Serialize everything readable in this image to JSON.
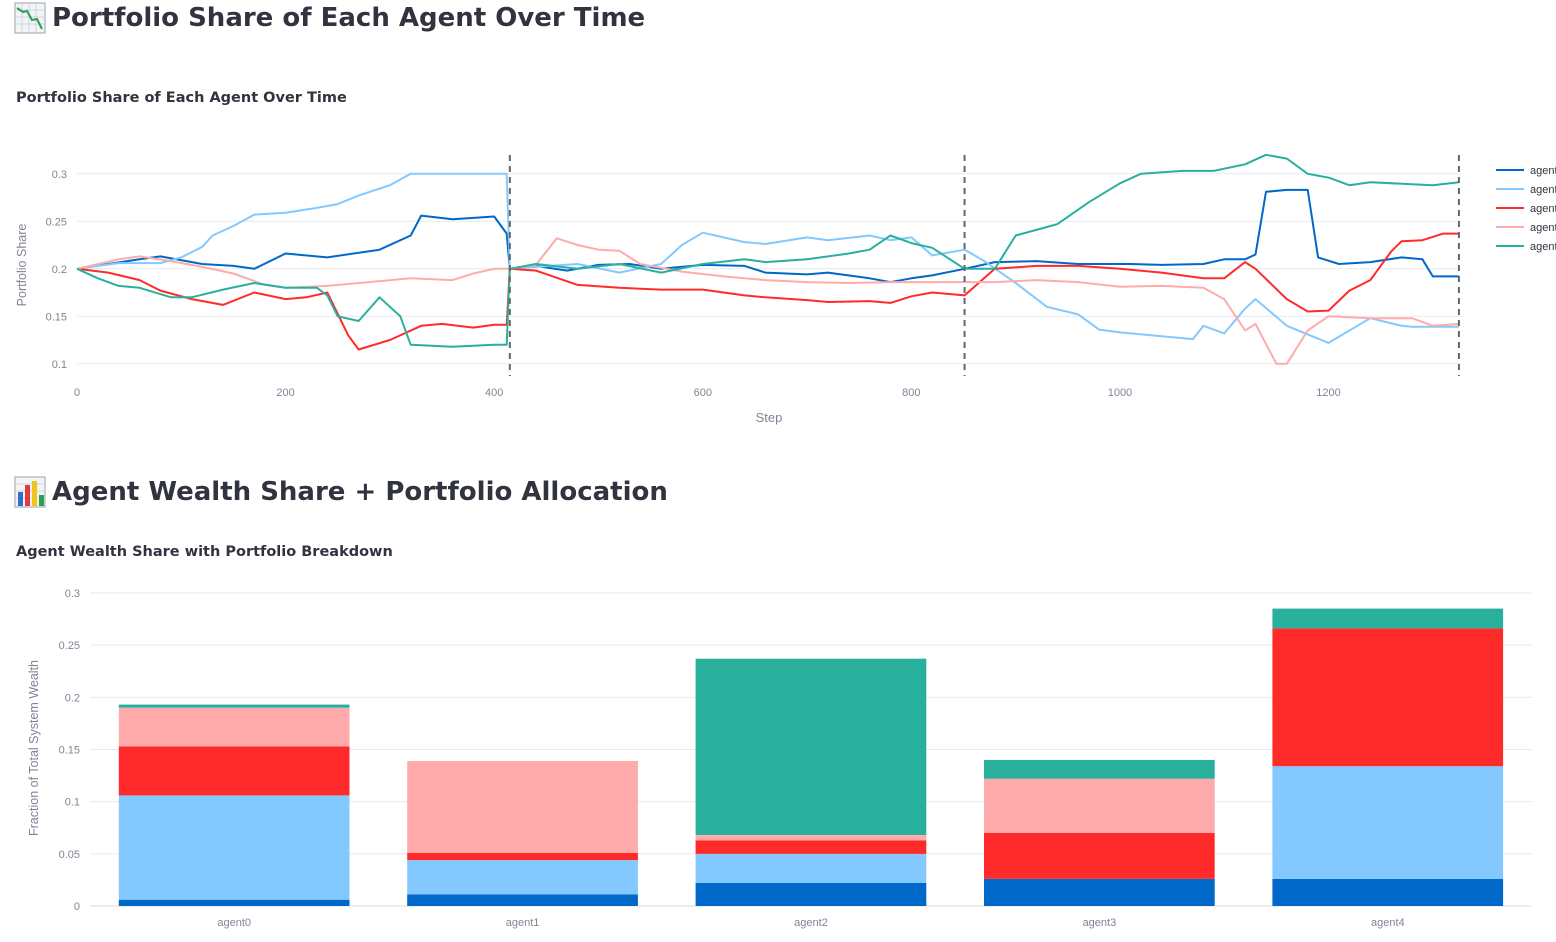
{
  "headings": {
    "line_section": "Portfolio Share of Each Agent Over Time",
    "line_icon": "chart-decreasing-icon",
    "bar_section": "Agent Wealth Share + Portfolio Allocation",
    "bar_icon": "bar-chart-icon"
  },
  "colors": {
    "agent0": "#0068c9",
    "agent1": "#83c9ff",
    "agent2": "#ff2b2b",
    "agent3": "#ffabab",
    "agent4": "#29b09d",
    "grid": "#e6e9ef",
    "axis_text": "#808495",
    "vline": "#666666"
  },
  "chart_data": [
    {
      "type": "line",
      "title": "Portfolio Share of Each Agent Over Time",
      "xlabel": "Step",
      "ylabel": "Portfolio Share",
      "xlim": [
        0,
        1327
      ],
      "ylim": [
        0.085,
        0.325
      ],
      "x_ticks": [
        0,
        200,
        400,
        600,
        800,
        1000,
        1200
      ],
      "y_ticks": [
        0.1,
        0.15,
        0.2,
        0.25,
        0.3
      ],
      "y_tick_labels": [
        "0.1",
        "0.15",
        "0.2",
        "0.25",
        "0.3"
      ],
      "vlines": [
        415,
        851,
        1325
      ],
      "grid": true,
      "legend": "right",
      "legend_labels": [
        "agent",
        "agent",
        "agent",
        "agent",
        "agent"
      ],
      "series": [
        {
          "color_key": "agent0",
          "x": [
            0,
            30,
            60,
            80,
            120,
            150,
            170,
            200,
            240,
            290,
            320,
            330,
            360,
            400,
            412,
            415,
            440,
            470,
            500,
            530,
            560,
            600,
            640,
            660,
            700,
            720,
            760,
            780,
            800,
            820,
            851,
            880,
            920,
            960,
            1010,
            1040,
            1080,
            1100,
            1120,
            1130,
            1140,
            1160,
            1180,
            1190,
            1210,
            1240,
            1270,
            1290,
            1300,
            1310,
            1325
          ],
          "y": [
            0.2,
            0.205,
            0.21,
            0.213,
            0.205,
            0.203,
            0.2,
            0.216,
            0.212,
            0.22,
            0.235,
            0.256,
            0.252,
            0.255,
            0.237,
            0.2,
            0.203,
            0.198,
            0.204,
            0.205,
            0.2,
            0.204,
            0.203,
            0.196,
            0.194,
            0.196,
            0.19,
            0.186,
            0.19,
            0.193,
            0.2,
            0.207,
            0.208,
            0.205,
            0.205,
            0.204,
            0.205,
            0.21,
            0.21,
            0.215,
            0.281,
            0.283,
            0.283,
            0.212,
            0.205,
            0.207,
            0.212,
            0.21,
            0.192,
            0.192,
            0.192
          ]
        },
        {
          "color_key": "agent1",
          "x": [
            0,
            40,
            80,
            100,
            120,
            130,
            150,
            170,
            200,
            230,
            250,
            270,
            300,
            320,
            380,
            400,
            412,
            415,
            440,
            480,
            520,
            560,
            580,
            600,
            640,
            660,
            700,
            720,
            760,
            780,
            800,
            820,
            851,
            870,
            900,
            930,
            960,
            980,
            1000,
            1040,
            1070,
            1080,
            1100,
            1120,
            1130,
            1160,
            1200,
            1240,
            1270,
            1280,
            1325
          ],
          "y": [
            0.2,
            0.206,
            0.206,
            0.212,
            0.223,
            0.235,
            0.245,
            0.257,
            0.259,
            0.264,
            0.268,
            0.277,
            0.288,
            0.3,
            0.3,
            0.3,
            0.3,
            0.2,
            0.202,
            0.205,
            0.196,
            0.205,
            0.225,
            0.238,
            0.228,
            0.226,
            0.233,
            0.23,
            0.235,
            0.23,
            0.233,
            0.214,
            0.22,
            0.208,
            0.185,
            0.16,
            0.152,
            0.136,
            0.133,
            0.129,
            0.126,
            0.14,
            0.132,
            0.158,
            0.168,
            0.14,
            0.122,
            0.148,
            0.14,
            0.139,
            0.139
          ]
        },
        {
          "color_key": "agent2",
          "x": [
            0,
            30,
            60,
            80,
            110,
            140,
            170,
            200,
            220,
            240,
            260,
            270,
            300,
            330,
            350,
            380,
            400,
            412,
            415,
            440,
            480,
            520,
            560,
            600,
            640,
            660,
            700,
            720,
            760,
            780,
            800,
            820,
            851,
            880,
            920,
            960,
            1000,
            1040,
            1080,
            1100,
            1120,
            1130,
            1160,
            1180,
            1200,
            1220,
            1240,
            1260,
            1270,
            1290,
            1310,
            1325
          ],
          "y": [
            0.2,
            0.196,
            0.188,
            0.177,
            0.168,
            0.162,
            0.175,
            0.168,
            0.17,
            0.175,
            0.13,
            0.115,
            0.125,
            0.14,
            0.142,
            0.138,
            0.141,
            0.141,
            0.2,
            0.198,
            0.183,
            0.18,
            0.178,
            0.178,
            0.172,
            0.17,
            0.167,
            0.165,
            0.166,
            0.164,
            0.171,
            0.175,
            0.172,
            0.2,
            0.203,
            0.203,
            0.2,
            0.196,
            0.19,
            0.19,
            0.207,
            0.2,
            0.168,
            0.155,
            0.156,
            0.177,
            0.188,
            0.218,
            0.229,
            0.23,
            0.237,
            0.237
          ]
        },
        {
          "color_key": "agent3",
          "x": [
            0,
            40,
            60,
            90,
            120,
            150,
            180,
            200,
            240,
            280,
            320,
            360,
            380,
            400,
            412,
            415,
            440,
            460,
            480,
            500,
            520,
            540,
            580,
            620,
            660,
            700,
            740,
            780,
            820,
            851,
            880,
            920,
            960,
            1000,
            1040,
            1080,
            1100,
            1120,
            1130,
            1150,
            1160,
            1180,
            1200,
            1240,
            1280,
            1300,
            1325
          ],
          "y": [
            0.2,
            0.21,
            0.213,
            0.208,
            0.202,
            0.195,
            0.183,
            0.18,
            0.182,
            0.186,
            0.19,
            0.188,
            0.195,
            0.2,
            0.2,
            0.2,
            0.204,
            0.232,
            0.225,
            0.22,
            0.219,
            0.205,
            0.197,
            0.192,
            0.188,
            0.186,
            0.185,
            0.186,
            0.186,
            0.186,
            0.186,
            0.188,
            0.186,
            0.181,
            0.182,
            0.18,
            0.168,
            0.135,
            0.142,
            0.1,
            0.1,
            0.135,
            0.15,
            0.148,
            0.148,
            0.14,
            0.142
          ]
        },
        {
          "color_key": "agent4",
          "x": [
            0,
            20,
            40,
            60,
            90,
            110,
            140,
            170,
            200,
            230,
            240,
            250,
            270,
            290,
            310,
            320,
            360,
            400,
            412,
            415,
            440,
            480,
            520,
            560,
            600,
            640,
            660,
            700,
            740,
            760,
            780,
            800,
            820,
            851,
            880,
            900,
            940,
            970,
            1000,
            1020,
            1060,
            1090,
            1120,
            1140,
            1160,
            1180,
            1200,
            1220,
            1240,
            1280,
            1300,
            1325
          ],
          "y": [
            0.2,
            0.19,
            0.182,
            0.18,
            0.17,
            0.17,
            0.178,
            0.185,
            0.18,
            0.18,
            0.172,
            0.15,
            0.145,
            0.17,
            0.15,
            0.12,
            0.118,
            0.12,
            0.12,
            0.2,
            0.205,
            0.2,
            0.205,
            0.196,
            0.205,
            0.21,
            0.207,
            0.21,
            0.216,
            0.22,
            0.235,
            0.227,
            0.222,
            0.2,
            0.2,
            0.235,
            0.247,
            0.27,
            0.29,
            0.3,
            0.303,
            0.303,
            0.31,
            0.32,
            0.316,
            0.3,
            0.296,
            0.288,
            0.291,
            0.289,
            0.288,
            0.291
          ]
        }
      ]
    },
    {
      "type": "bar",
      "barmode": "stack",
      "title": "Agent Wealth Share with Portfolio Breakdown",
      "xlabel": "",
      "ylabel": "Fraction of Total System Wealth",
      "ylim": [
        0,
        0.3
      ],
      "y_ticks": [
        0,
        0.05,
        0.1,
        0.15,
        0.2,
        0.25,
        0.3
      ],
      "y_tick_labels": [
        "0",
        "0.05",
        "0.1",
        "0.15",
        "0.2",
        "0.25",
        "0.3"
      ],
      "categories": [
        "agent0",
        "agent1",
        "agent2",
        "agent3",
        "agent4"
      ],
      "grid": true,
      "series": [
        {
          "color_key": "agent0",
          "values": [
            0.006,
            0.011,
            0.022,
            0.026,
            0.026
          ]
        },
        {
          "color_key": "agent1",
          "values": [
            0.1,
            0.033,
            0.028,
            0.0,
            0.108
          ]
        },
        {
          "color_key": "agent2",
          "values": [
            0.047,
            0.007,
            0.013,
            0.044,
            0.132
          ]
        },
        {
          "color_key": "agent3",
          "values": [
            0.037,
            0.088,
            0.005,
            0.052,
            0.0
          ]
        },
        {
          "color_key": "agent4",
          "values": [
            0.003,
            0.0,
            0.169,
            0.018,
            0.019
          ]
        }
      ]
    }
  ]
}
